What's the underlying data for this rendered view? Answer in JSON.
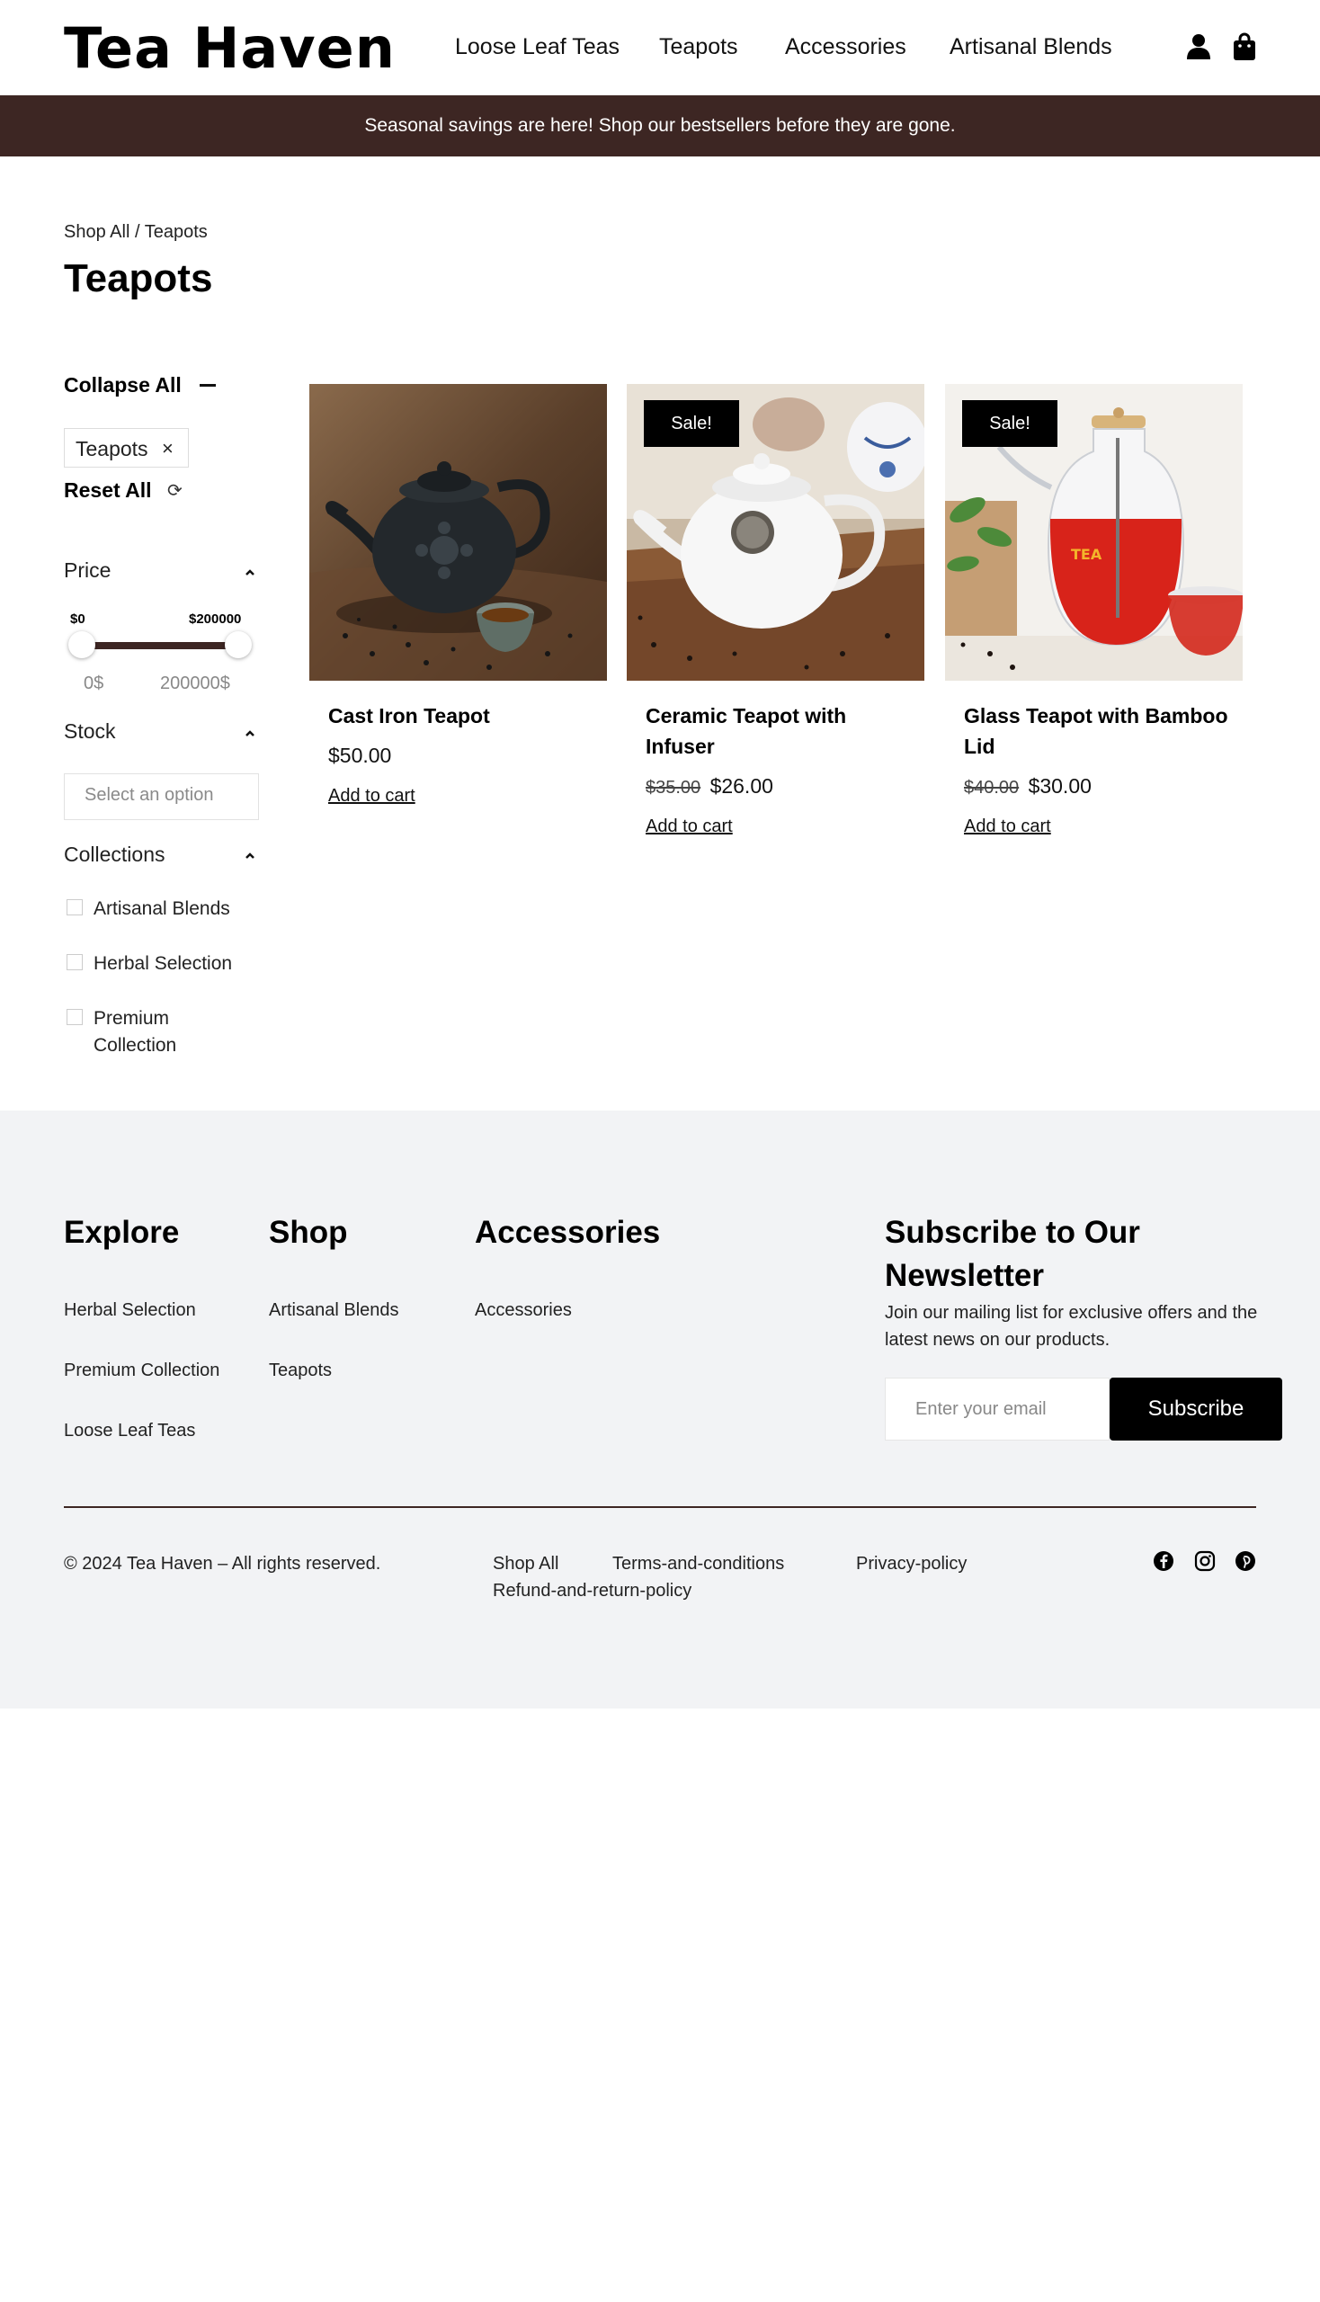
{
  "brand": {
    "logo": "Tea Haven",
    "accent": "#3d2623"
  },
  "nav": {
    "items": [
      "Loose Leaf Teas",
      "Teapots",
      "Accessories",
      "Artisanal Blends"
    ]
  },
  "header_icons": [
    "account-icon",
    "cart-icon"
  ],
  "promo": {
    "text": "Seasonal savings are here! Shop our bestsellers before they are gone."
  },
  "breadcrumb": "Shop All / Teapots",
  "page_title": "Teapots",
  "sidebar": {
    "collapse_all": "Collapse All",
    "active_chip": "Teapots",
    "chip_remove": "×",
    "reset_all": "Reset All",
    "price": {
      "title": "Price",
      "range_min_label": "$0",
      "range_max_label": "$200000",
      "min_value": "0$",
      "max_value": "200000$"
    },
    "stock": {
      "title": "Stock",
      "placeholder": "Select an option"
    },
    "collections": {
      "title": "Collections",
      "options": [
        "Artisanal Blends",
        "Herbal Selection",
        "Premium Collection"
      ]
    }
  },
  "products": [
    {
      "name": "Cast Iron Teapot",
      "old_price": "",
      "price": "$50.00",
      "cta": "Add to cart",
      "badge": ""
    },
    {
      "name": "Ceramic Teapot with Infuser",
      "old_price": "$35.00",
      "price": "$26.00",
      "cta": "Add to cart",
      "badge": "Sale!"
    },
    {
      "name": "Glass Teapot with Bamboo Lid",
      "old_price": "$40.00",
      "price": "$30.00",
      "cta": "Add to cart",
      "badge": "Sale!"
    }
  ],
  "footer": {
    "explore": {
      "title": "Explore",
      "links": [
        "Herbal Selection",
        "Premium Collection",
        "Loose Leaf Teas"
      ]
    },
    "shop": {
      "title": "Shop",
      "links": [
        "Artisanal Blends",
        "Teapots"
      ]
    },
    "accessories": {
      "title": "Accessories",
      "links": [
        "Accessories"
      ]
    },
    "newsletter": {
      "title": "Subscribe to Our Newsletter",
      "description": "Join our mailing list for exclusive offers and the latest news on our products.",
      "placeholder": "Enter your email",
      "button": "Subscribe"
    },
    "copyright": "© 2024 Tea Haven – All rights reserved.",
    "legal_links": [
      "Shop All",
      "Terms-and-conditions",
      "Privacy-policy",
      "Refund-and-return-policy"
    ],
    "social": [
      "facebook-icon",
      "instagram-icon",
      "pinterest-icon"
    ]
  }
}
